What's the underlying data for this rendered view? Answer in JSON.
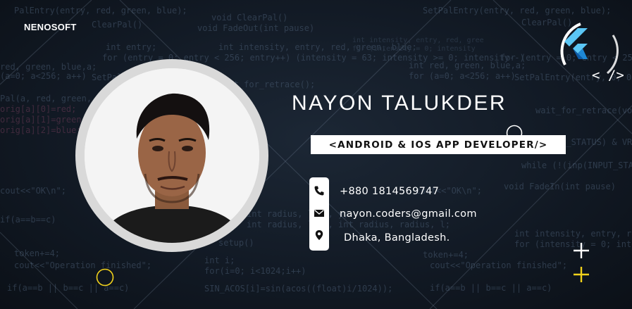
{
  "brand": {
    "name": "NENOSOFT"
  },
  "profile": {
    "name": "NAYON TALUKDER",
    "role": "<ANDROID & IOS APP DEVELOPER/>"
  },
  "contacts": {
    "phone": "+880 1814569747",
    "email": "nayon.coders@gmail.com",
    "location": "Dhaka, Bangladesh."
  },
  "logo": {
    "code_tag": "< />"
  },
  "colors": {
    "accent_yellow": "#f2d21b",
    "flutter_light": "#5bc6f5",
    "flutter_dark": "#0d5aa7",
    "background": "#121a25"
  },
  "icons": [
    "phone-icon",
    "email-icon",
    "location-pin-icon",
    "flutter-logo-icon",
    "plus-icon"
  ]
}
